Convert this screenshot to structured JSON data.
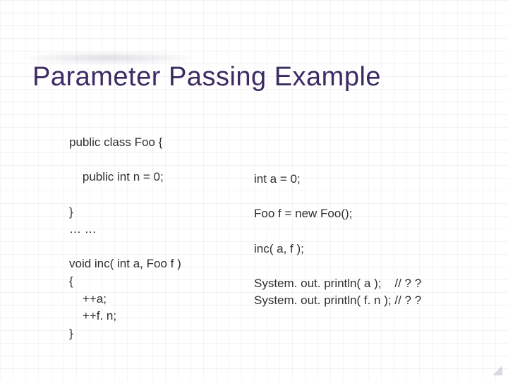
{
  "title": "Parameter Passing Example",
  "code_left": "public class Foo {\n\n    public int n = 0;\n\n}\n… …\n\nvoid inc( int a, Foo f )\n{\n    ++a;\n    ++f. n;\n}",
  "code_right": "int a = 0;\n\nFoo f = new Foo();\n\ninc( a, f );\n\nSystem. out. println( a );    // ? ?\nSystem. out. println( f. n ); // ? ?"
}
